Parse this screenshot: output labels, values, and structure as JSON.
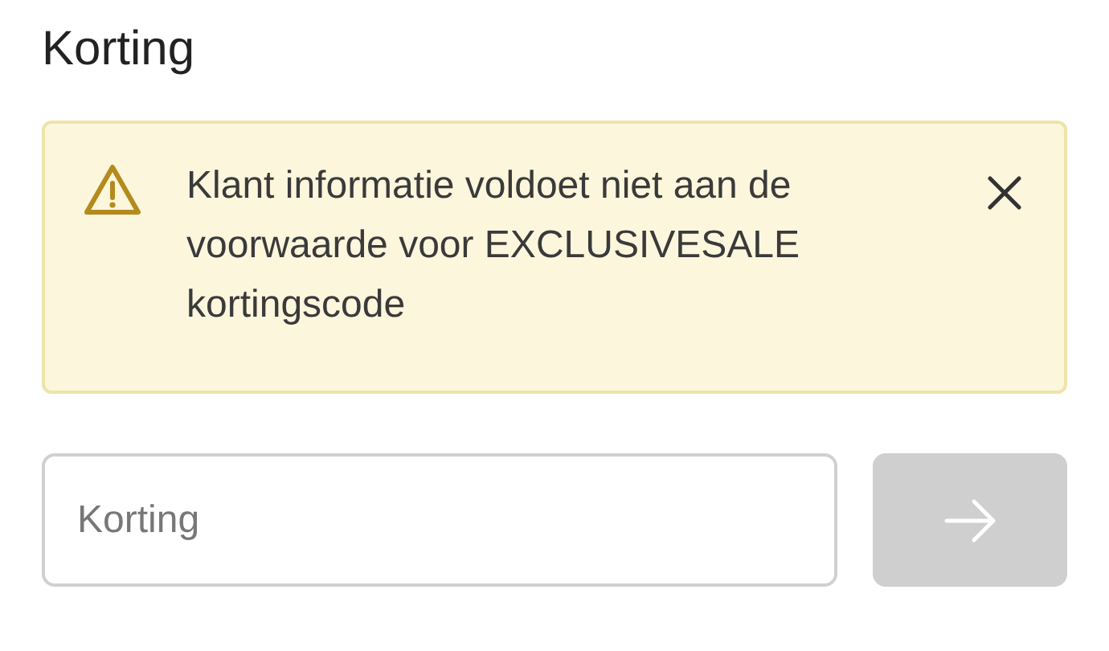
{
  "heading": "Korting",
  "alert": {
    "message": "Klant informatie voldoet niet aan de voorwaarde voor EXCLUSIVESALE kortingscode"
  },
  "discount_field": {
    "placeholder": "Korting"
  },
  "submit_button": {
    "disabled": true
  }
}
